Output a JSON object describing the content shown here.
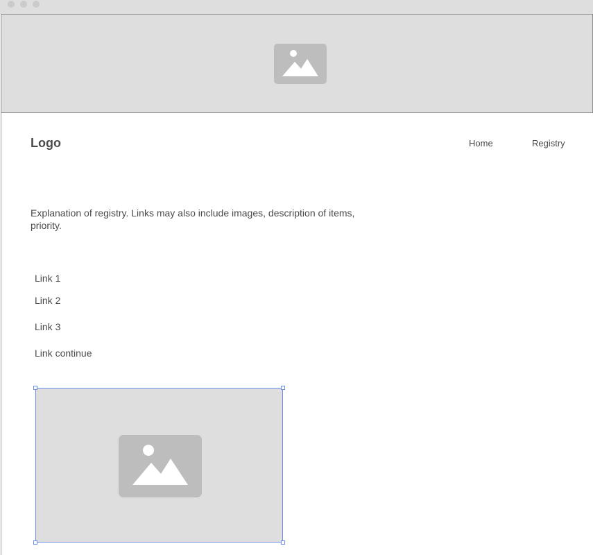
{
  "header": {
    "logo": "Logo",
    "nav": [
      {
        "label": "Home"
      },
      {
        "label": "Registry"
      }
    ]
  },
  "hero": {
    "icon": "image-placeholder-icon"
  },
  "main": {
    "explanation": "Explanation of registry. Links may also include images, description of items, priority.",
    "links": [
      {
        "label": "Link 1"
      },
      {
        "label": "Link 2"
      },
      {
        "label": "Link 3"
      },
      {
        "label": "Link continue"
      }
    ],
    "image": {
      "icon": "image-placeholder-icon"
    }
  },
  "colors": {
    "placeholder_fill": "#dedede",
    "icon_fill": "#bdbdbd",
    "selection": "#6b8ee8",
    "text": "#4a4a4a"
  }
}
